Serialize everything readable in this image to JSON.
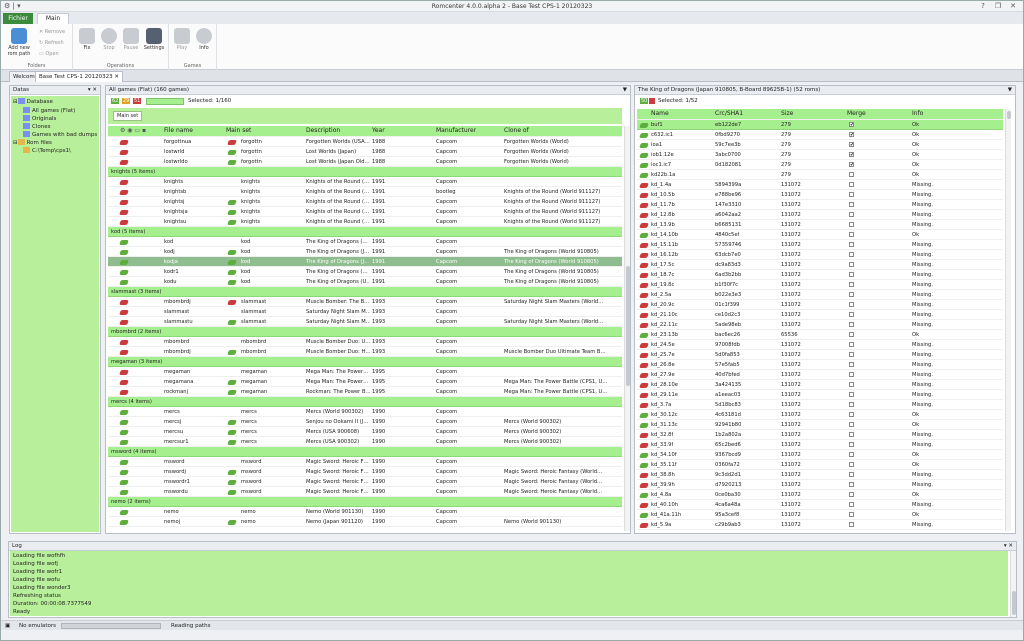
{
  "window": {
    "title": "Romcenter 4.0.0.alpha 2 - Base Test CPS-1 20120323"
  },
  "ribbon": {
    "file_tab": "Fichier",
    "main_tab": "Main",
    "folders": {
      "label": "Folders",
      "add": "Add new rom path",
      "remove": "Remove",
      "refresh": "Refresh",
      "open": "Open"
    },
    "operations": {
      "label": "Operations",
      "fix": "Fix",
      "stop": "Stop",
      "pause": "Pause",
      "settings": "Settings"
    },
    "games": {
      "label": "Games",
      "play": "Play",
      "info": "Info"
    }
  },
  "doc_tabs": [
    "Welcome",
    "Base Test CPS-1 20120323"
  ],
  "datas": {
    "title": "Datas",
    "nodes": [
      "Database",
      "All games (Flat)",
      "Originals",
      "Clones",
      "Games with bad dumps",
      "Rom files",
      "C:\\Temp\\cps1\\"
    ]
  },
  "games_panel": {
    "title": "All games (Flat) (160 games)",
    "counts": [
      "62",
      "29",
      "51"
    ],
    "selected": "Selected: 1/160",
    "group_label": "Main set",
    "columns": [
      "File name",
      "Main set",
      "Description",
      "Year",
      "Manufacturer",
      "Clone of"
    ],
    "rows": [
      {
        "t": "r",
        "c": "r",
        "f": "forgottnua",
        "m": "forgottn",
        "d": "Forgotten Worlds (USA…",
        "y": "1988",
        "mf": "Capcom",
        "cl": "Forgotten Worlds (World)"
      },
      {
        "t": "r",
        "c": "g",
        "f": "lostwrld",
        "m": "forgottn",
        "d": "Lost Worlds (Japan)",
        "y": "1988",
        "mf": "Capcom",
        "cl": "Forgotten Worlds (World)"
      },
      {
        "t": "r",
        "c": "g",
        "f": "lostwrldo",
        "m": "forgottn",
        "d": "Lost Worlds (Japan Old…",
        "y": "1988",
        "mf": "Capcom",
        "cl": "Forgotten Worlds (World)"
      },
      {
        "t": "g",
        "label": "knights (5 items)"
      },
      {
        "t": "r",
        "c": "",
        "f": "knights",
        "m": "knights",
        "d": "Knights of the Round (…",
        "y": "1991",
        "mf": "Capcom",
        "cl": ""
      },
      {
        "t": "r",
        "c": "",
        "f": "knightsb",
        "m": "knights",
        "d": "Knights of the Round (…",
        "y": "1991",
        "mf": "bootleg",
        "cl": "Knights of the Round (World 911127)"
      },
      {
        "t": "r",
        "c": "g",
        "f": "knightsj",
        "m": "knights",
        "d": "Knights of the Round (…",
        "y": "1991",
        "mf": "Capcom",
        "cl": "Knights of the Round (World 911127)"
      },
      {
        "t": "r",
        "c": "g",
        "f": "knightsja",
        "m": "knights",
        "d": "Knights of the Round (…",
        "y": "1991",
        "mf": "Capcom",
        "cl": "Knights of the Round (World 911127)"
      },
      {
        "t": "r",
        "c": "g",
        "f": "knightsu",
        "m": "knights",
        "d": "Knights of the Round (…",
        "y": "1991",
        "mf": "Capcom",
        "cl": "Knights of the Round (World 911127)"
      },
      {
        "t": "g",
        "label": "kod (5 items)"
      },
      {
        "t": "g2",
        "c": "",
        "f": "kod",
        "m": "kod",
        "d": "The King of Dragons (…",
        "y": "1991",
        "mf": "Capcom",
        "cl": ""
      },
      {
        "t": "g2",
        "c": "g",
        "f": "kodj",
        "m": "kod",
        "d": "The King of Dragons (J…",
        "y": "1991",
        "mf": "Capcom",
        "cl": "The King of Dragons (World 910805)"
      },
      {
        "t": "sel",
        "c": "g",
        "f": "kodja",
        "m": "kod",
        "d": "The King of Dragons (J…",
        "y": "1991",
        "mf": "Capcom",
        "cl": "The King of Dragons (World 910805)"
      },
      {
        "t": "g2",
        "c": "g",
        "f": "kodr1",
        "m": "kod",
        "d": "The King of Dragons (…",
        "y": "1991",
        "mf": "Capcom",
        "cl": "The King of Dragons (World 910805)"
      },
      {
        "t": "g2",
        "c": "g",
        "f": "kodu",
        "m": "kod",
        "d": "The King of Dragons (U…",
        "y": "1991",
        "mf": "Capcom",
        "cl": "The King of Dragons (World 910805)"
      },
      {
        "t": "g",
        "label": "slammast (3 items)"
      },
      {
        "t": "r",
        "c": "r",
        "f": "mbombrdj",
        "m": "slammast",
        "d": "Muscle Bomber: The B…",
        "y": "1993",
        "mf": "Capcom",
        "cl": "Saturday Night Slam Masters (World…"
      },
      {
        "t": "r",
        "c": "",
        "f": "slammast",
        "m": "slammast",
        "d": "Saturday Night Slam M…",
        "y": "1993",
        "mf": "Capcom",
        "cl": ""
      },
      {
        "t": "r",
        "c": "g",
        "f": "slammastu",
        "m": "slammast",
        "d": "Saturday Night Slam M…",
        "y": "1993",
        "mf": "Capcom",
        "cl": "Saturday Night Slam Masters (World…"
      },
      {
        "t": "g",
        "label": "mbombrd (2 items)"
      },
      {
        "t": "r",
        "c": "",
        "f": "mbombrd",
        "m": "mbombrd",
        "d": "Muscle Bomber Duo: U…",
        "y": "1993",
        "mf": "Capcom",
        "cl": ""
      },
      {
        "t": "r",
        "c": "g",
        "f": "mbombrdj",
        "m": "mbombrd",
        "d": "Muscle Bomber Duo: H…",
        "y": "1993",
        "mf": "Capcom",
        "cl": "Muscle Bomber Duo Ultimate Team B…"
      },
      {
        "t": "g",
        "label": "megaman (3 items)"
      },
      {
        "t": "r",
        "c": "",
        "f": "megaman",
        "m": "megaman",
        "d": "Mega Man: The Power…",
        "y": "1995",
        "mf": "Capcom",
        "cl": ""
      },
      {
        "t": "r",
        "c": "g",
        "f": "megamana",
        "m": "megaman",
        "d": "Mega Man: The Power…",
        "y": "1995",
        "mf": "Capcom",
        "cl": "Mega Man: The Power Battle (CPS1, U…"
      },
      {
        "t": "r",
        "c": "g",
        "f": "rockmanj",
        "m": "megaman",
        "d": "Rockman: The Power B…",
        "y": "1995",
        "mf": "Capcom",
        "cl": "Mega Man: The Power Battle (CPS1, U…"
      },
      {
        "t": "g",
        "label": "mercs (4 items)"
      },
      {
        "t": "g2",
        "c": "",
        "f": "mercs",
        "m": "mercs",
        "d": "Mercs (World 900302)",
        "y": "1990",
        "mf": "Capcom",
        "cl": ""
      },
      {
        "t": "g2",
        "c": "g",
        "f": "mercsj",
        "m": "mercs",
        "d": "Senjou no Ookami II (J…",
        "y": "1990",
        "mf": "Capcom",
        "cl": "Mercs (World 900302)"
      },
      {
        "t": "g2",
        "c": "g",
        "f": "mercsu",
        "m": "mercs",
        "d": "Mercs (USA 900608)",
        "y": "1990",
        "mf": "Capcom",
        "cl": "Mercs (World 900302)"
      },
      {
        "t": "g2",
        "c": "g",
        "f": "mercsur1",
        "m": "mercs",
        "d": "Mercs (USA 900302)",
        "y": "1990",
        "mf": "Capcom",
        "cl": "Mercs (World 900302)"
      },
      {
        "t": "g",
        "label": "msword (4 items)"
      },
      {
        "t": "g2",
        "c": "",
        "f": "msword",
        "m": "msword",
        "d": "Magic Sword: Heroic F…",
        "y": "1990",
        "mf": "Capcom",
        "cl": ""
      },
      {
        "t": "g2",
        "c": "g",
        "f": "mswordj",
        "m": "msword",
        "d": "Magic Sword: Heroic F…",
        "y": "1990",
        "mf": "Capcom",
        "cl": "Magic Sword: Heroic Fantasy (World…"
      },
      {
        "t": "g2",
        "c": "g",
        "f": "mswordr1",
        "m": "msword",
        "d": "Magic Sword: Heroic F…",
        "y": "1990",
        "mf": "Capcom",
        "cl": "Magic Sword: Heroic Fantasy (World…"
      },
      {
        "t": "g2",
        "c": "g",
        "f": "mswordu",
        "m": "msword",
        "d": "Magic Sword: Heroic F…",
        "y": "1990",
        "mf": "Capcom",
        "cl": "Magic Sword: Heroic Fantasy (World…"
      },
      {
        "t": "g",
        "label": "nemo (2 items)"
      },
      {
        "t": "g2",
        "c": "",
        "f": "nemo",
        "m": "nemo",
        "d": "Nemo (World 901130)",
        "y": "1990",
        "mf": "Capcom",
        "cl": ""
      },
      {
        "t": "g2",
        "c": "g",
        "f": "nemoj",
        "m": "nemo",
        "d": "Nemo (Japan 901120)",
        "y": "1990",
        "mf": "Capcom",
        "cl": "Nemo (World 901130)"
      }
    ]
  },
  "roms_panel": {
    "title": "The King of Dragons (Japan 910805, B-Board 89625B-1) (52 roms)",
    "counts": [
      "50"
    ],
    "selected": "Selected: 1/52",
    "columns": [
      "Name",
      "Crc/SHA1",
      "Size",
      "Merge",
      "Info"
    ],
    "rows": [
      {
        "s": "ok",
        "n": "buf1",
        "c": "eb122de7",
        "z": "279",
        "m": true,
        "i": "Ok",
        "sel": true
      },
      {
        "s": "ok",
        "n": "c632.ic1",
        "c": "0fbd9270",
        "z": "279",
        "m": true,
        "i": "Ok"
      },
      {
        "s": "ok",
        "n": "ioa1",
        "c": "59c7ee3b",
        "z": "279",
        "m": true,
        "i": "Ok"
      },
      {
        "s": "ok",
        "n": "iob1.12e",
        "c": "3abc0700",
        "z": "279",
        "m": true,
        "i": "Ok"
      },
      {
        "s": "ok",
        "n": "ioc1.ic7",
        "c": "0d182081",
        "z": "279",
        "m": true,
        "i": "Ok"
      },
      {
        "s": "ok",
        "n": "kd22b.1a",
        "c": "",
        "z": "279",
        "m": false,
        "i": "Ok"
      },
      {
        "s": "miss",
        "n": "kd_1.4a",
        "c": "5894399a",
        "z": "131072",
        "m": false,
        "i": "Missing."
      },
      {
        "s": "miss",
        "n": "kd_10.5b",
        "c": "e788be96",
        "z": "131072",
        "m": false,
        "i": "Missing."
      },
      {
        "s": "miss",
        "n": "kd_11.7b",
        "c": "147e3310",
        "z": "131072",
        "m": false,
        "i": "Missing."
      },
      {
        "s": "miss",
        "n": "kd_12.8b",
        "c": "a6042aa2",
        "z": "131072",
        "m": false,
        "i": "Missing."
      },
      {
        "s": "miss",
        "n": "kd_13.9b",
        "c": "b6685131",
        "z": "131072",
        "m": false,
        "i": "Missing."
      },
      {
        "s": "ok",
        "n": "kd_14.10b",
        "c": "4840c5ef",
        "z": "131072",
        "m": false,
        "i": "Ok"
      },
      {
        "s": "miss",
        "n": "kd_15.11b",
        "c": "57359746",
        "z": "131072",
        "m": false,
        "i": "Missing."
      },
      {
        "s": "miss",
        "n": "kd_16.12b",
        "c": "63dcb7e0",
        "z": "131072",
        "m": false,
        "i": "Missing."
      },
      {
        "s": "miss",
        "n": "kd_17.5c",
        "c": "dc9a83d3",
        "z": "131072",
        "m": false,
        "i": "Missing."
      },
      {
        "s": "miss",
        "n": "kd_18.7c",
        "c": "6ad3b2bb",
        "z": "131072",
        "m": false,
        "i": "Missing."
      },
      {
        "s": "miss",
        "n": "kd_19.8c",
        "c": "b1f30f7c",
        "z": "131072",
        "m": false,
        "i": "Missing."
      },
      {
        "s": "miss",
        "n": "kd_2.5a",
        "c": "b022e3e3",
        "z": "131072",
        "m": false,
        "i": "Missing."
      },
      {
        "s": "miss",
        "n": "kd_20.9c",
        "c": "01c1f399",
        "z": "131072",
        "m": false,
        "i": "Missing."
      },
      {
        "s": "miss",
        "n": "kd_21.10c",
        "c": "ce10d2c3",
        "z": "131072",
        "m": false,
        "i": "Missing."
      },
      {
        "s": "miss",
        "n": "kd_22.11c",
        "c": "5ade98eb",
        "z": "131072",
        "m": false,
        "i": "Missing."
      },
      {
        "s": "ok",
        "n": "kd_23.13b",
        "c": "bac6ec26",
        "z": "65536",
        "m": false,
        "i": "Ok"
      },
      {
        "s": "miss",
        "n": "kd_24.5e",
        "c": "97008fdb",
        "z": "131072",
        "m": false,
        "i": "Missing."
      },
      {
        "s": "miss",
        "n": "kd_25.7e",
        "c": "5d0fa853",
        "z": "131072",
        "m": false,
        "i": "Missing."
      },
      {
        "s": "miss",
        "n": "kd_26.8e",
        "c": "57e5fab5",
        "z": "131072",
        "m": false,
        "i": "Missing."
      },
      {
        "s": "miss",
        "n": "kd_27.9e",
        "c": "40d7bfed",
        "z": "131072",
        "m": false,
        "i": "Missing."
      },
      {
        "s": "miss",
        "n": "kd_28.10e",
        "c": "3a424135",
        "z": "131072",
        "m": false,
        "i": "Missing."
      },
      {
        "s": "miss",
        "n": "kd_29.11e",
        "c": "a1eeac03",
        "z": "131072",
        "m": false,
        "i": "Missing."
      },
      {
        "s": "miss",
        "n": "kd_3.7a",
        "c": "5d18bc83",
        "z": "131072",
        "m": false,
        "i": "Missing."
      },
      {
        "s": "ok",
        "n": "kd_30.12c",
        "c": "4c63181d",
        "z": "131072",
        "m": false,
        "i": "Ok"
      },
      {
        "s": "ok",
        "n": "kd_31.13c",
        "c": "92941b80",
        "z": "131072",
        "m": false,
        "i": "Ok"
      },
      {
        "s": "miss",
        "n": "kd_32.8f",
        "c": "1b2a802a",
        "z": "131072",
        "m": false,
        "i": "Missing."
      },
      {
        "s": "miss",
        "n": "kd_33.9f",
        "c": "65c2bed6",
        "z": "131072",
        "m": false,
        "i": "Missing."
      },
      {
        "s": "ok",
        "n": "kd_34.10f",
        "c": "9367bcd9",
        "z": "131072",
        "m": false,
        "i": "Ok"
      },
      {
        "s": "ok",
        "n": "kd_35.11f",
        "c": "0360fa72",
        "z": "131072",
        "m": false,
        "i": "Ok"
      },
      {
        "s": "miss",
        "n": "kd_38.8h",
        "c": "9c3dd2d1",
        "z": "131072",
        "m": false,
        "i": "Missing."
      },
      {
        "s": "miss",
        "n": "kd_39.9h",
        "c": "d7920213",
        "z": "131072",
        "m": false,
        "i": "Missing."
      },
      {
        "s": "ok",
        "n": "kd_4.8a",
        "c": "0ce0ba30",
        "z": "131072",
        "m": false,
        "i": "Ok"
      },
      {
        "s": "miss",
        "n": "kd_40.10h",
        "c": "4ca6a48a",
        "z": "131072",
        "m": false,
        "i": "Missing."
      },
      {
        "s": "ok",
        "n": "kd_41a.11h",
        "c": "95a3cef8",
        "z": "131072",
        "m": false,
        "i": "Ok"
      },
      {
        "s": "miss",
        "n": "kd_5.9a",
        "c": "c29b9ab3",
        "z": "131072",
        "m": false,
        "i": "Missing."
      }
    ]
  },
  "log": {
    "title": "Log",
    "lines": [
      "Loading file wofhfh",
      "Loading file wofj",
      "Loading file wofr1",
      "Loading file wofu",
      "Loading file wonder3",
      "Refreshing status",
      "Duration: 00:00:08.7377549",
      "Ready"
    ]
  },
  "status": {
    "emulators": "No emulators",
    "task": "Reading paths"
  },
  "colors": {
    "accent": "#a6ef8e",
    "missing": "#cc3b3b",
    "ok": "#5eae3e",
    "file_tab": "#3c8a3c"
  }
}
